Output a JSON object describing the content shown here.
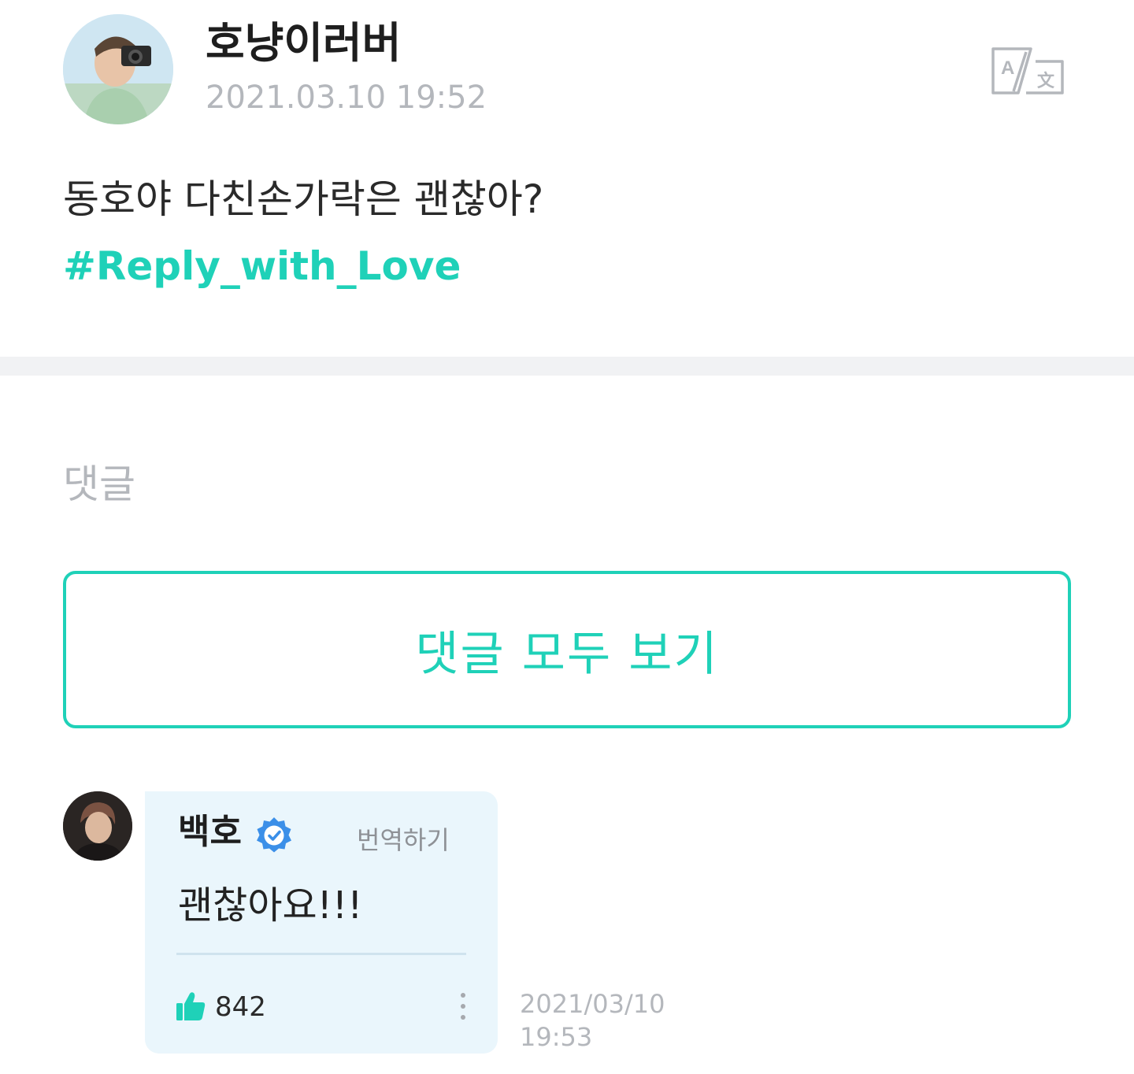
{
  "post": {
    "author": "호냥이러버",
    "date": "2021.03.10 19:52",
    "body": "동호야 다친손가락은 괜찮아?",
    "hashtag": "#Reply_with_Love",
    "translate_icon": "translate-icon"
  },
  "comments_section": {
    "heading": "댓글",
    "view_all_label": "댓글 모두 보기"
  },
  "comment": {
    "author": "백호",
    "verified_icon": "verified-badge-icon",
    "translate_label": "번역하기",
    "text": "괜찮아요!!!",
    "like_icon": "thumbs-up-icon",
    "like_count": "842",
    "more_icon": "more-vertical-icon",
    "date": "2021/03/10",
    "time": "19:53"
  },
  "colors": {
    "accent": "#1fd1b8",
    "muted_text": "#b4b7bc",
    "bubble_bg": "#eaf6fc",
    "verified_blue": "#3b8fe8"
  }
}
